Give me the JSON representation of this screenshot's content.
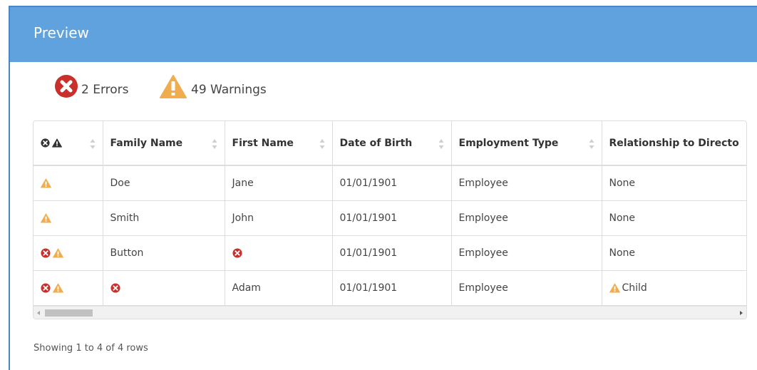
{
  "header": {
    "title": "Preview",
    "color": "#5fa2dd"
  },
  "summary": {
    "errors_label": "2 Errors",
    "warnings_label": "49 Warnings",
    "error_color": "#c9302c",
    "warning_color": "#f0ad4e"
  },
  "table": {
    "columns": [
      "",
      "Family Name",
      "First Name",
      "Date of Birth",
      "Employment Type",
      "Relationship to Directo"
    ],
    "rows": [
      {
        "status": [
          "warning"
        ],
        "family": "Doe",
        "family_icon": "",
        "first": "Jane",
        "first_icon": "",
        "dob": "01/01/1901",
        "employment": "Employee",
        "relationship": "None",
        "relationship_icon": ""
      },
      {
        "status": [
          "warning"
        ],
        "family": "Smith",
        "family_icon": "",
        "first": "John",
        "first_icon": "",
        "dob": "01/01/1901",
        "employment": "Employee",
        "relationship": "None",
        "relationship_icon": ""
      },
      {
        "status": [
          "error",
          "warning"
        ],
        "family": "Button",
        "family_icon": "",
        "first": "",
        "first_icon": "error",
        "dob": "01/01/1901",
        "employment": "Employee",
        "relationship": "None",
        "relationship_icon": ""
      },
      {
        "status": [
          "error",
          "warning"
        ],
        "family": "",
        "family_icon": "error",
        "first": "Adam",
        "first_icon": "",
        "dob": "01/01/1901",
        "employment": "Employee",
        "relationship": "Child",
        "relationship_icon": "warning"
      }
    ]
  },
  "footer": {
    "text": "Showing 1 to 4 of 4 rows"
  },
  "icons": {
    "error": "times-circle-icon",
    "warning": "warning-triangle-icon"
  }
}
